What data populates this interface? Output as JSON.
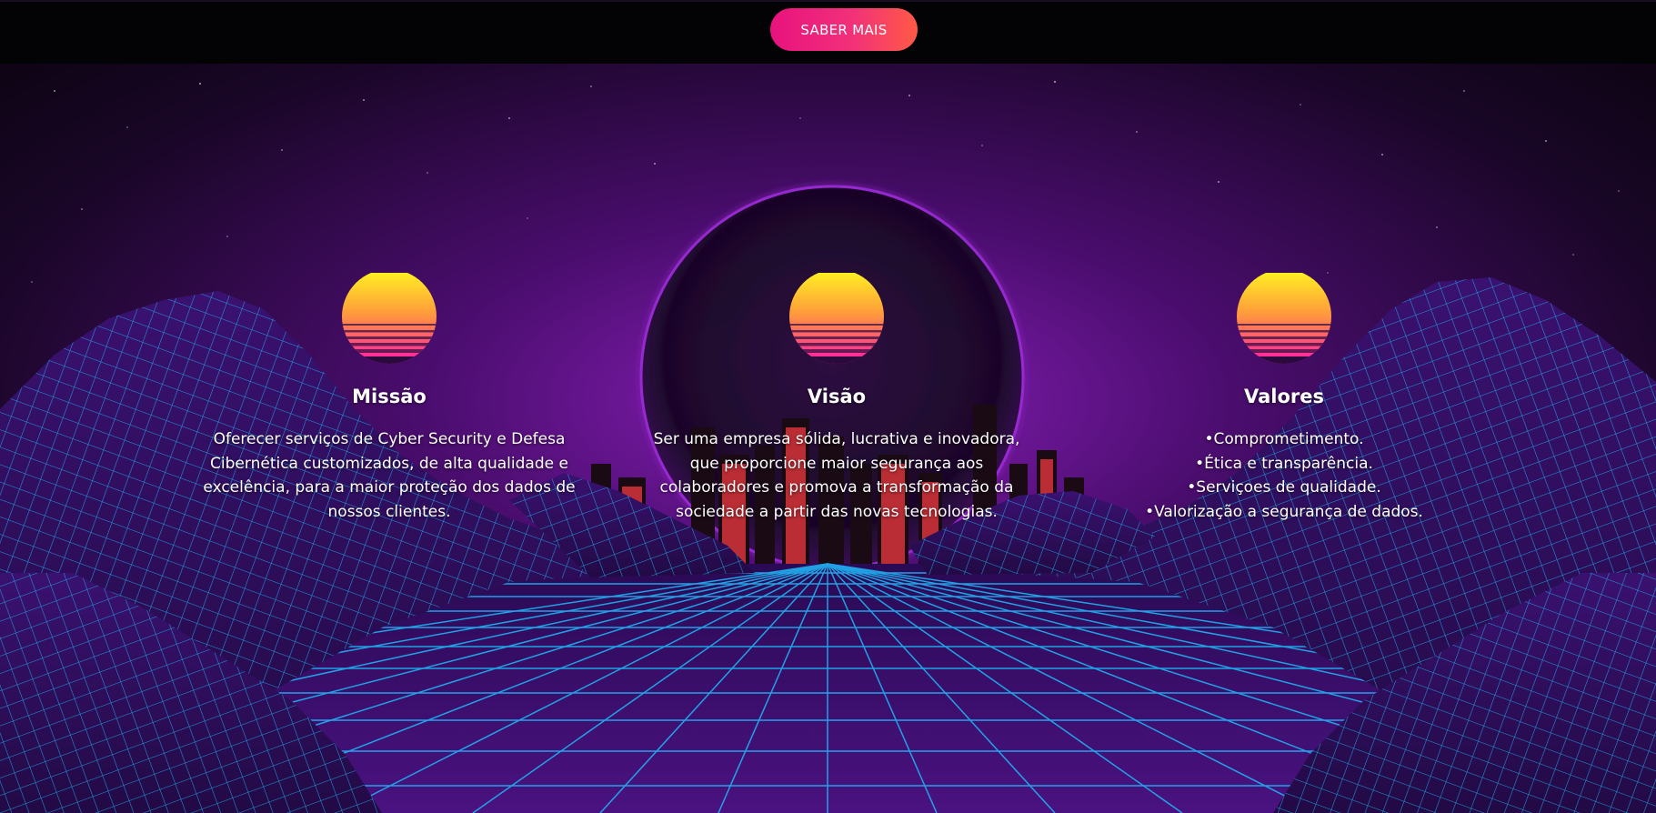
{
  "header": {
    "cta_label": "SABER MAIS"
  },
  "colors": {
    "accent_start": "#e8127e",
    "accent_end": "#ff5a45",
    "grid": "#1fb3f5",
    "sky_top": "#0b0410",
    "sky_glow": "#8a1fb8",
    "sun_top": "#ffee22",
    "sun_bottom": "#ff1aa8"
  },
  "cards": [
    {
      "icon": "retro-sun-icon",
      "title": "Missão",
      "text": "Oferecer serviços de Cyber Security e Defesa Cibernética customizados, de alta qualidade e excelência, para a maior proteção dos dados de nossos clientes."
    },
    {
      "icon": "retro-sun-icon",
      "title": "Visão",
      "text": "Ser uma empresa sólida, lucrativa e inovadora, que proporcione maior segurança aos colaboradores e promova a transformação da sociedade a partir das novas tecnologias."
    },
    {
      "icon": "retro-sun-icon",
      "title": "Valores",
      "values": [
        "Comprometimento.",
        "Ética e transparência.",
        "Serviçoes de qualidade.",
        "Valorização a segurança de dados."
      ]
    }
  ]
}
